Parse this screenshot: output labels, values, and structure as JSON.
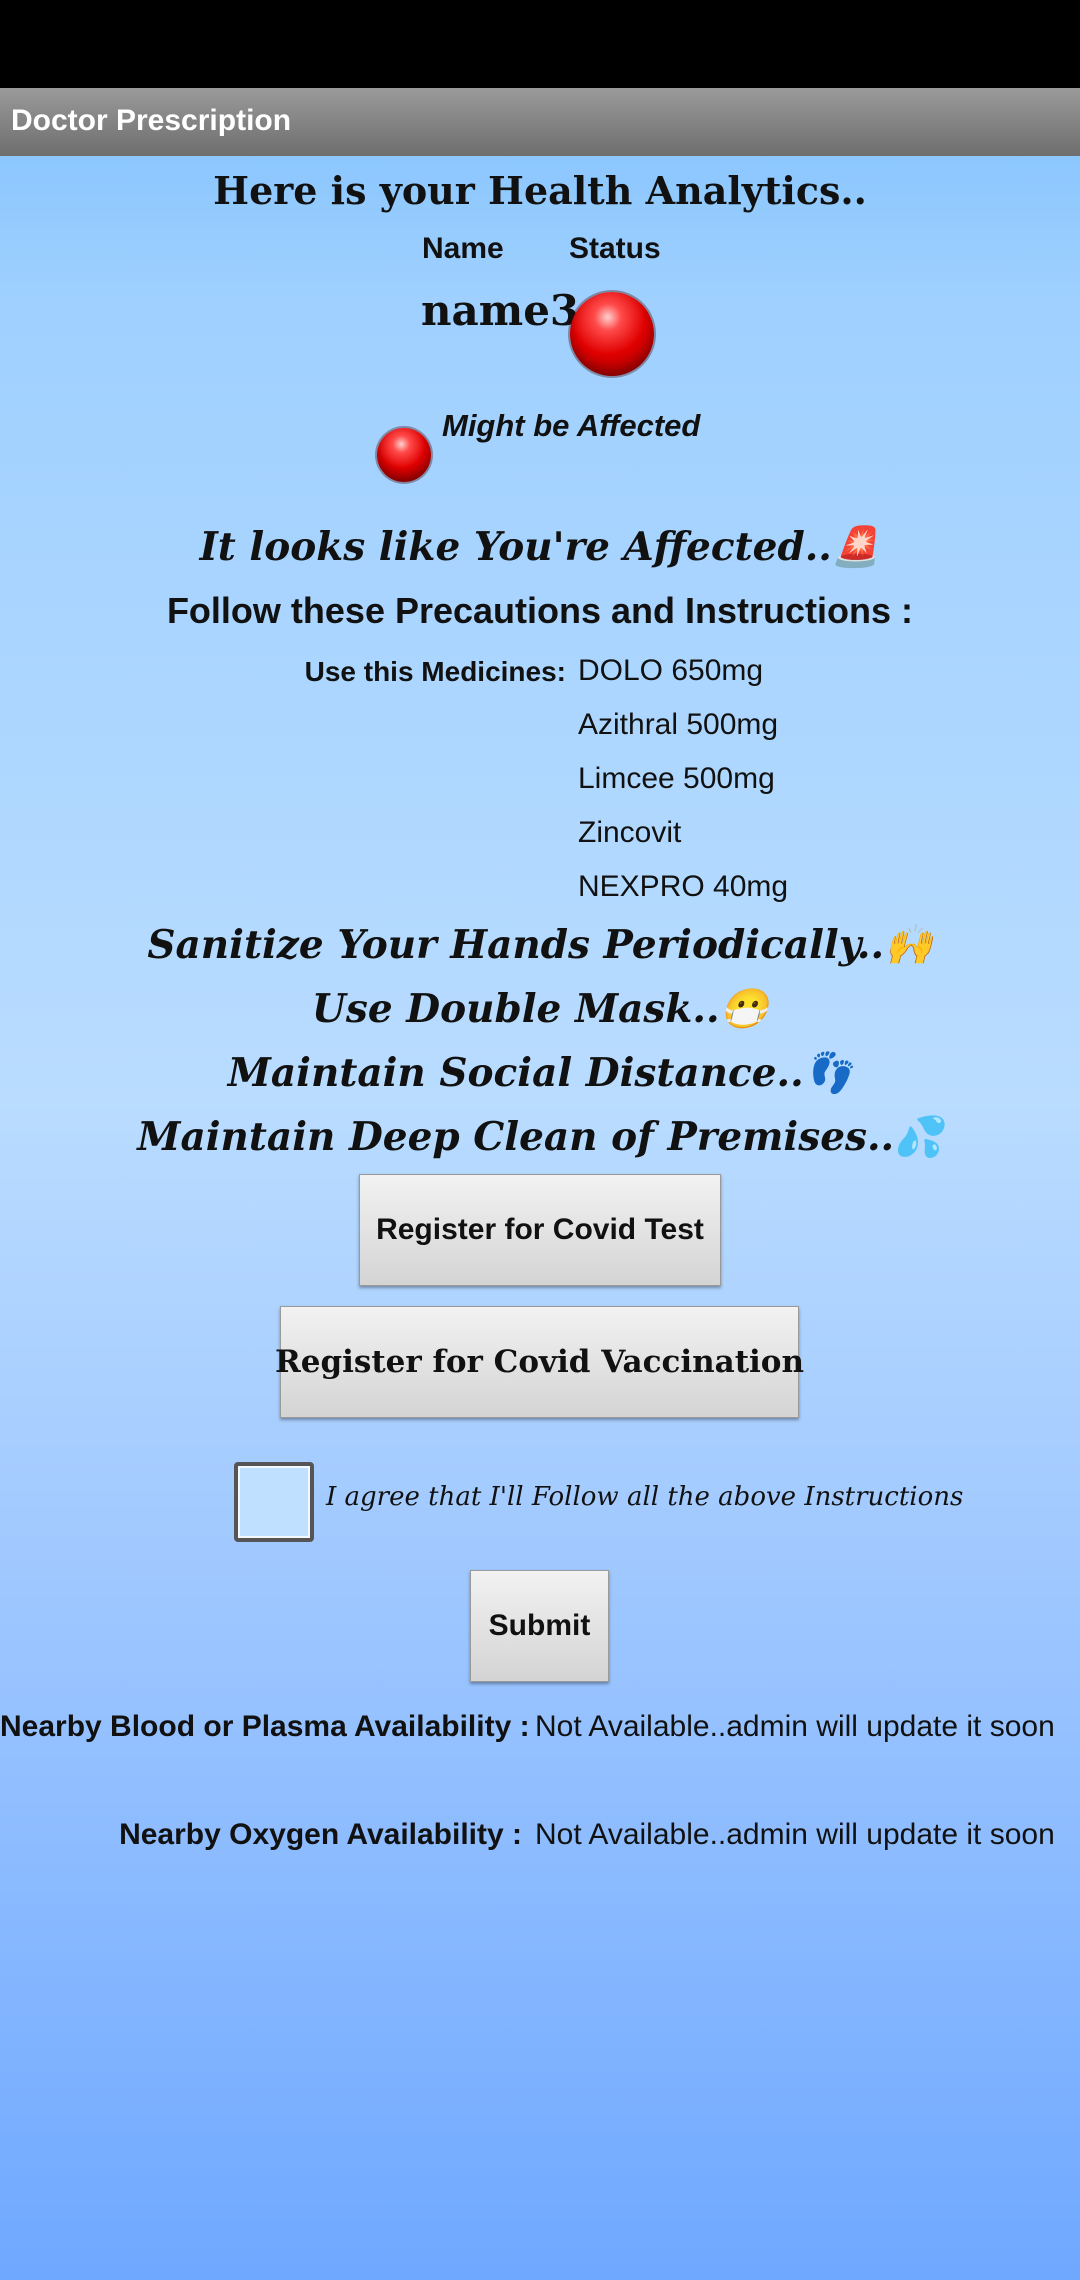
{
  "app": {
    "title": "Doctor Prescription"
  },
  "analytics": {
    "heading": "Here is your Health Analytics..",
    "name_header": "Name",
    "status_header": "Status",
    "name_value": "name3",
    "legend_text": "Might be Affected"
  },
  "advice": {
    "affected_text": "It looks like You're Affected..🚨",
    "follow_text": "Follow these Precautions and Instructions :",
    "medicines_label": "Use this Medicines:",
    "medicines": [
      "DOLO 650mg",
      "Azithral 500mg",
      "Limcee 500mg",
      "Zincovit",
      "NEXPRO 40mg"
    ],
    "tips": [
      "Sanitize Your Hands Periodically..🙌",
      "Use Double Mask..😷",
      "Maintain Social Distance..👣",
      "Maintain Deep Clean of Premises..💦"
    ]
  },
  "actions": {
    "covid_test_label": "Register for Covid Test",
    "vaccination_label": "Register for Covid Vaccination",
    "agree_label": "I agree that I'll Follow all the above Instructions",
    "agree_checked": false,
    "submit_label": "Submit"
  },
  "availability": {
    "blood_label": "Nearby Blood or Plasma Availability :",
    "blood_value": "Not Available..admin will update it soon",
    "oxygen_label": "Nearby Oxygen Availability :",
    "oxygen_value": "Not Available..admin will update it soon"
  },
  "colors": {
    "status": "#e00000",
    "appbar": "#808080"
  }
}
